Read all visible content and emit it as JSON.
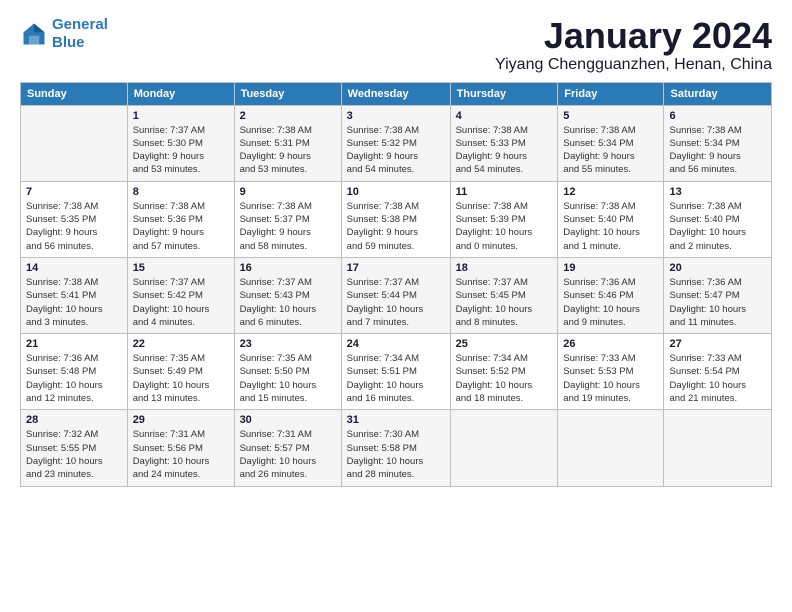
{
  "logo": {
    "line1": "General",
    "line2": "Blue"
  },
  "title": "January 2024",
  "location": "Yiyang Chengguanzhen, Henan, China",
  "days_header": [
    "Sunday",
    "Monday",
    "Tuesday",
    "Wednesday",
    "Thursday",
    "Friday",
    "Saturday"
  ],
  "weeks": [
    [
      {
        "num": "",
        "info": ""
      },
      {
        "num": "1",
        "info": "Sunrise: 7:37 AM\nSunset: 5:30 PM\nDaylight: 9 hours\nand 53 minutes."
      },
      {
        "num": "2",
        "info": "Sunrise: 7:38 AM\nSunset: 5:31 PM\nDaylight: 9 hours\nand 53 minutes."
      },
      {
        "num": "3",
        "info": "Sunrise: 7:38 AM\nSunset: 5:32 PM\nDaylight: 9 hours\nand 54 minutes."
      },
      {
        "num": "4",
        "info": "Sunrise: 7:38 AM\nSunset: 5:33 PM\nDaylight: 9 hours\nand 54 minutes."
      },
      {
        "num": "5",
        "info": "Sunrise: 7:38 AM\nSunset: 5:34 PM\nDaylight: 9 hours\nand 55 minutes."
      },
      {
        "num": "6",
        "info": "Sunrise: 7:38 AM\nSunset: 5:34 PM\nDaylight: 9 hours\nand 56 minutes."
      }
    ],
    [
      {
        "num": "7",
        "info": "Sunrise: 7:38 AM\nSunset: 5:35 PM\nDaylight: 9 hours\nand 56 minutes."
      },
      {
        "num": "8",
        "info": "Sunrise: 7:38 AM\nSunset: 5:36 PM\nDaylight: 9 hours\nand 57 minutes."
      },
      {
        "num": "9",
        "info": "Sunrise: 7:38 AM\nSunset: 5:37 PM\nDaylight: 9 hours\nand 58 minutes."
      },
      {
        "num": "10",
        "info": "Sunrise: 7:38 AM\nSunset: 5:38 PM\nDaylight: 9 hours\nand 59 minutes."
      },
      {
        "num": "11",
        "info": "Sunrise: 7:38 AM\nSunset: 5:39 PM\nDaylight: 10 hours\nand 0 minutes."
      },
      {
        "num": "12",
        "info": "Sunrise: 7:38 AM\nSunset: 5:40 PM\nDaylight: 10 hours\nand 1 minute."
      },
      {
        "num": "13",
        "info": "Sunrise: 7:38 AM\nSunset: 5:40 PM\nDaylight: 10 hours\nand 2 minutes."
      }
    ],
    [
      {
        "num": "14",
        "info": "Sunrise: 7:38 AM\nSunset: 5:41 PM\nDaylight: 10 hours\nand 3 minutes."
      },
      {
        "num": "15",
        "info": "Sunrise: 7:37 AM\nSunset: 5:42 PM\nDaylight: 10 hours\nand 4 minutes."
      },
      {
        "num": "16",
        "info": "Sunrise: 7:37 AM\nSunset: 5:43 PM\nDaylight: 10 hours\nand 6 minutes."
      },
      {
        "num": "17",
        "info": "Sunrise: 7:37 AM\nSunset: 5:44 PM\nDaylight: 10 hours\nand 7 minutes."
      },
      {
        "num": "18",
        "info": "Sunrise: 7:37 AM\nSunset: 5:45 PM\nDaylight: 10 hours\nand 8 minutes."
      },
      {
        "num": "19",
        "info": "Sunrise: 7:36 AM\nSunset: 5:46 PM\nDaylight: 10 hours\nand 9 minutes."
      },
      {
        "num": "20",
        "info": "Sunrise: 7:36 AM\nSunset: 5:47 PM\nDaylight: 10 hours\nand 11 minutes."
      }
    ],
    [
      {
        "num": "21",
        "info": "Sunrise: 7:36 AM\nSunset: 5:48 PM\nDaylight: 10 hours\nand 12 minutes."
      },
      {
        "num": "22",
        "info": "Sunrise: 7:35 AM\nSunset: 5:49 PM\nDaylight: 10 hours\nand 13 minutes."
      },
      {
        "num": "23",
        "info": "Sunrise: 7:35 AM\nSunset: 5:50 PM\nDaylight: 10 hours\nand 15 minutes."
      },
      {
        "num": "24",
        "info": "Sunrise: 7:34 AM\nSunset: 5:51 PM\nDaylight: 10 hours\nand 16 minutes."
      },
      {
        "num": "25",
        "info": "Sunrise: 7:34 AM\nSunset: 5:52 PM\nDaylight: 10 hours\nand 18 minutes."
      },
      {
        "num": "26",
        "info": "Sunrise: 7:33 AM\nSunset: 5:53 PM\nDaylight: 10 hours\nand 19 minutes."
      },
      {
        "num": "27",
        "info": "Sunrise: 7:33 AM\nSunset: 5:54 PM\nDaylight: 10 hours\nand 21 minutes."
      }
    ],
    [
      {
        "num": "28",
        "info": "Sunrise: 7:32 AM\nSunset: 5:55 PM\nDaylight: 10 hours\nand 23 minutes."
      },
      {
        "num": "29",
        "info": "Sunrise: 7:31 AM\nSunset: 5:56 PM\nDaylight: 10 hours\nand 24 minutes."
      },
      {
        "num": "30",
        "info": "Sunrise: 7:31 AM\nSunset: 5:57 PM\nDaylight: 10 hours\nand 26 minutes."
      },
      {
        "num": "31",
        "info": "Sunrise: 7:30 AM\nSunset: 5:58 PM\nDaylight: 10 hours\nand 28 minutes."
      },
      {
        "num": "",
        "info": ""
      },
      {
        "num": "",
        "info": ""
      },
      {
        "num": "",
        "info": ""
      }
    ]
  ]
}
